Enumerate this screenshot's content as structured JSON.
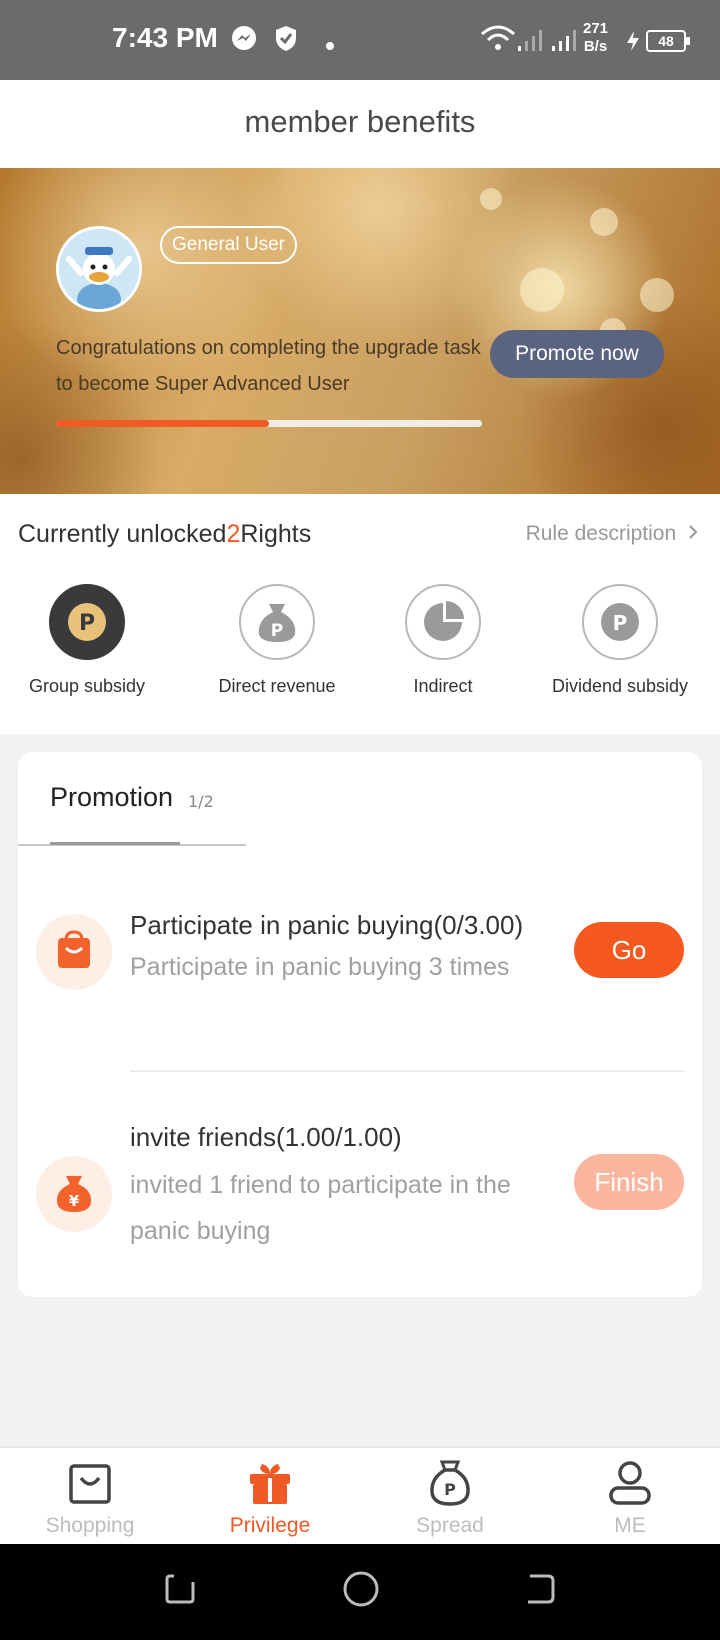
{
  "status_bar": {
    "time": "7:43 PM",
    "net_speed_value": "271",
    "net_speed_unit": "B/s",
    "battery": "48",
    "icons": [
      "messenger-icon",
      "shield-icon",
      "dot-icon",
      "wifi-icon",
      "signal-icon",
      "signal-icon",
      "charging-icon",
      "battery-icon"
    ]
  },
  "header": {
    "title": "member benefits"
  },
  "banner": {
    "badge": "General User",
    "message": "Congratulations on completing the upgrade task to become Super Advanced User",
    "promote_button": "Promote now",
    "progress": 0.5
  },
  "rights": {
    "heading_prefix": "Currently unlocked",
    "count": "2",
    "heading_suffix": "Rights",
    "rule_link": "Rule description",
    "items": [
      {
        "label": "Group subsidy",
        "icon": "p-coin-icon",
        "active": true
      },
      {
        "label": "Direct revenue",
        "icon": "money-bag-icon",
        "active": false
      },
      {
        "label": "Indirect",
        "icon": "pie-chart-icon",
        "active": false
      },
      {
        "label": "Dividend subsidy",
        "icon": "p-coin-icon",
        "active": false
      }
    ]
  },
  "promotion": {
    "tab_label": "Promotion",
    "page": "1/2",
    "tasks": [
      {
        "title": "Participate in panic buying(0/3.00)",
        "description": "Participate in panic buying 3 times",
        "button": "Go",
        "icon": "shopping-bag-icon"
      },
      {
        "title": "invite friends(1.00/1.00)",
        "description": "invited 1 friend to participate in the panic buying",
        "button": "Finish",
        "icon": "yuan-bag-icon"
      }
    ]
  },
  "bottom_nav": {
    "items": [
      {
        "label": "Shopping",
        "icon": "shopping-bag-icon",
        "active": false
      },
      {
        "label": "Privilege",
        "icon": "gift-icon",
        "active": true
      },
      {
        "label": "Spread",
        "icon": "p-bag-icon",
        "active": false
      },
      {
        "label": "ME",
        "icon": "person-icon",
        "active": false
      }
    ]
  },
  "colors": {
    "accent": "#f05a25",
    "promote_button": "#5a6481",
    "status_bar": "#6b6b6b",
    "finish_button": "#fbb6a0"
  }
}
